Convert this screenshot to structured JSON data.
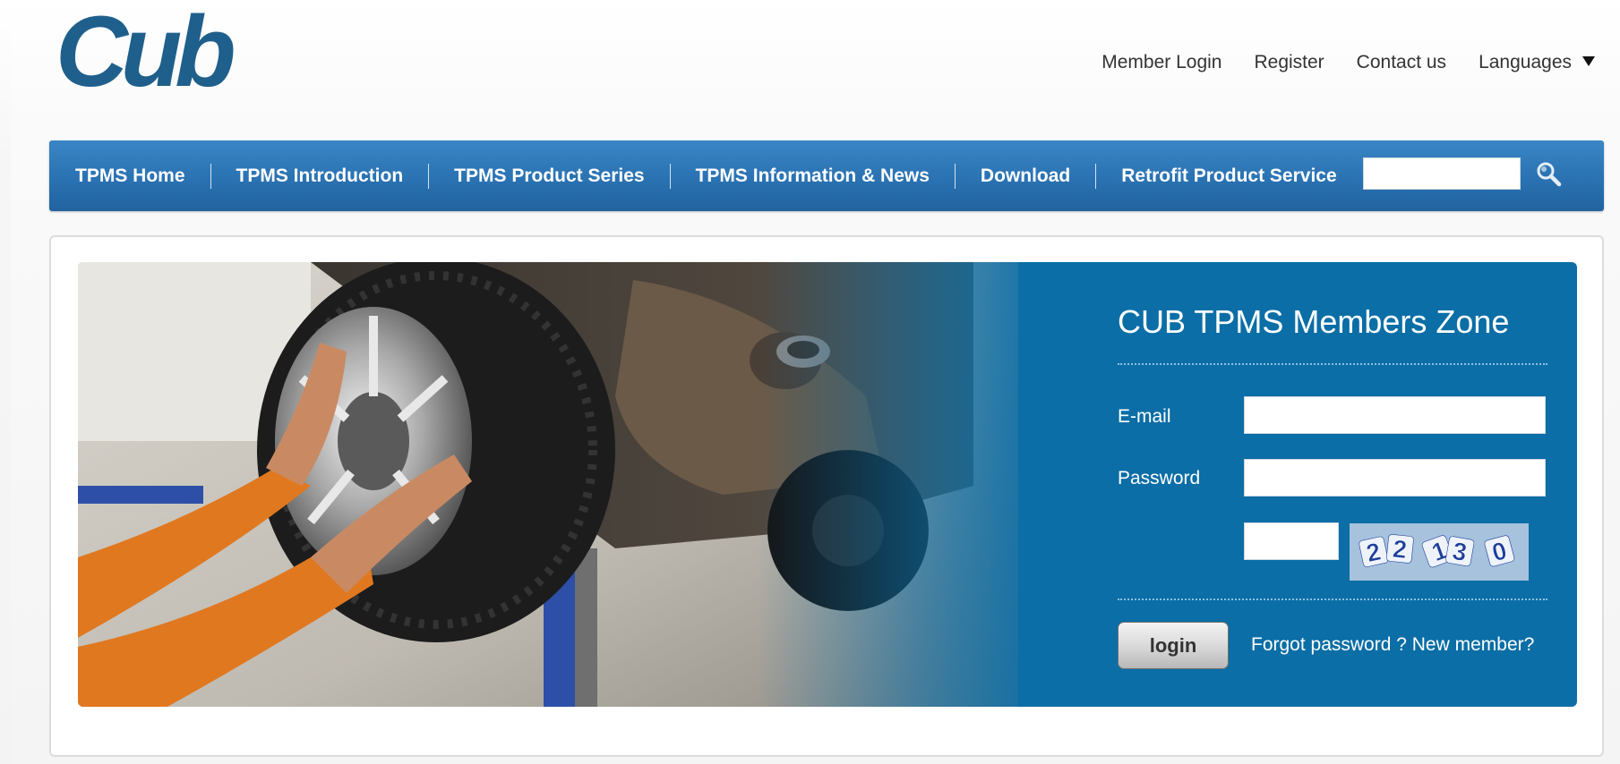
{
  "brand": {
    "logo_text": "Cub",
    "color": "#1f5f8b"
  },
  "top_links": {
    "member_login": "Member Login",
    "register": "Register",
    "contact": "Contact us",
    "languages": "Languages"
  },
  "nav": {
    "items": [
      "TPMS Home",
      "TPMS Introduction",
      "TPMS Product Series",
      "TPMS Information & News",
      "Download",
      "Retrofit Product Service"
    ],
    "search_placeholder": "",
    "search_icon": "search-icon",
    "accent": "#2a72b2"
  },
  "login": {
    "title": "CUB TPMS Members Zone",
    "email_label": "E-mail",
    "email_value": "",
    "password_label": "Password",
    "password_value": "",
    "captcha_value": "",
    "captcha_code": "22130",
    "button_label": "login",
    "forgot_label": "Forgot password ?",
    "new_member_label": "New member?",
    "panel_color": "#0b6ea6"
  }
}
